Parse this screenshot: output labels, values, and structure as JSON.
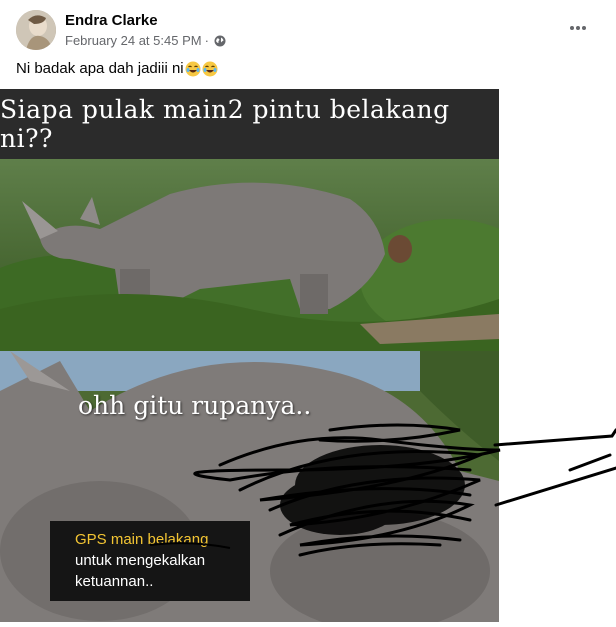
{
  "post": {
    "author": "Endra Clarke",
    "timestamp": "February 24 at 5:45 PM",
    "separator": "·",
    "audience_icon": "globe-icon",
    "more_icon": "more-options-icon",
    "caption": "Ni badak apa dah jadiii ni",
    "caption_emojis": [
      "laughing-emoji",
      "laughing-emoji"
    ]
  },
  "meme": {
    "top_text": "Siapa pulak main2 pintu belakang ni??",
    "middle_text": "ohh gitu rupanya..",
    "box_lines": [
      "GPS main belakang",
      "untuk mengekalkan",
      "ketuannan.."
    ]
  },
  "colors": {
    "name_text": "#050505",
    "meta_text": "#65676b",
    "banner_bg": "#2b2b2b",
    "box_bg": "#151515",
    "box_highlight": "#f3c533",
    "grass": "#3f6b2a",
    "rhino": "#7e7a78"
  }
}
